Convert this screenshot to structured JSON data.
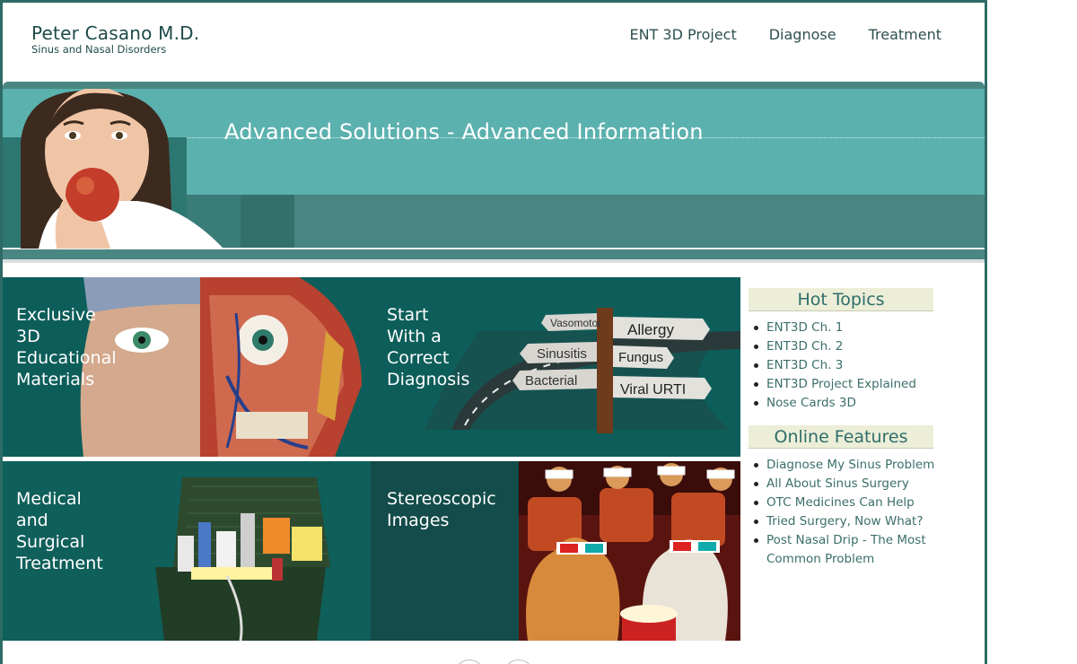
{
  "header": {
    "name": "Peter Casano M.D.",
    "tagline": "Sinus and Nasal Disorders",
    "nav": [
      {
        "label": "ENT 3D Project"
      },
      {
        "label": "Diagnose"
      },
      {
        "label": "Treatment"
      }
    ]
  },
  "banner": {
    "title": "Advanced Solutions - Advanced Information"
  },
  "tiles": [
    {
      "label": "Exclusive\n3D\nEducational\nMaterials"
    },
    {
      "label": "Start\nWith a\nCorrect\nDiagnosis"
    },
    {
      "label": "Medical\nand\nSurgical\nTreatment"
    },
    {
      "label": "Stereoscopic\nImages"
    }
  ],
  "signs": [
    "Vasomotor",
    "Allergy",
    "Sinusitis",
    "Fungus",
    "Bacterial",
    "Viral URTI"
  ],
  "sidebar": {
    "hot_topics": {
      "title": "Hot Topics",
      "items": [
        "ENT3D Ch. 1",
        "ENT3D Ch. 2",
        "ENT3D Ch. 3",
        "ENT3D Project Explained",
        "Nose Cards 3D"
      ]
    },
    "online_features": {
      "title": "Online Features",
      "items": [
        "Diagnose My Sinus Problem",
        "All About Sinus Surgery",
        "OTC Medicines Can Help",
        "Tried Surgery, Now What?",
        "Post Nasal Drip - The Most Common Problem"
      ]
    }
  },
  "colors": {
    "teal_light": "#5bb1ae",
    "teal_dark": "#0d5e5a",
    "border": "#2e6b66",
    "sidebar_head_bg": "#eceed8"
  }
}
